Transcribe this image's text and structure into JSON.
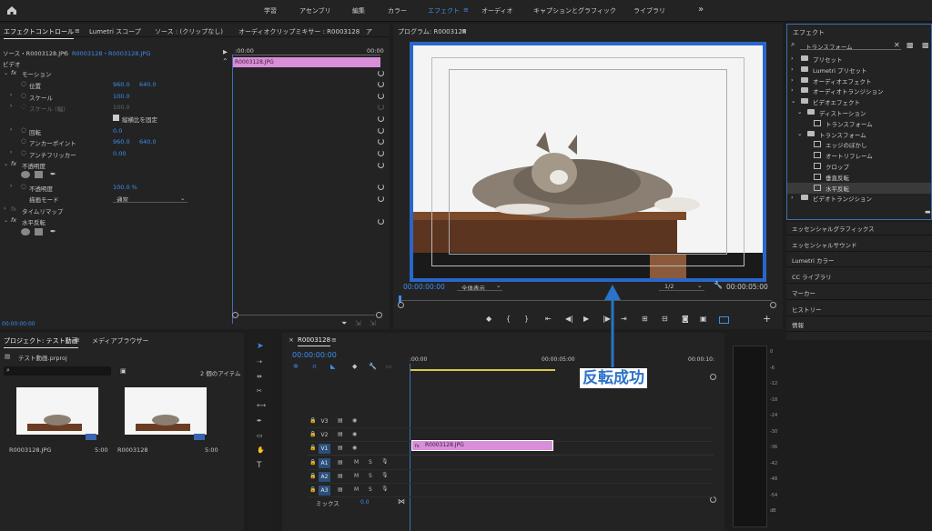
{
  "workspaces": [
    "学習",
    "アセンブリ",
    "編集",
    "カラー",
    "エフェクト",
    "オーディオ",
    "キャプションとグラフィック",
    "ライブラリ"
  ],
  "workspaces_active": "エフェクト",
  "home_icon": "home-icon",
  "more_icon": "»",
  "ec": {
    "tabs": [
      "エフェクトコントロール",
      "Lumetri スコープ",
      "ソース : (クリップなし)",
      "オーディオクリップミキサー : R0003128"
    ],
    "more": "ア",
    "source": "ソース・R0003128.JPG",
    "seq": "R0003128・R0003128.JPG",
    "time_start": ":00:00",
    "time_end": "00:00",
    "clip": "R0003128.JPG",
    "video": "ビデオ",
    "motion": "モーション",
    "position": "位置",
    "pos_x": "960.0",
    "pos_y": "640.0",
    "scale": "スケール",
    "scale_val": "100.0",
    "scale_w": "スケール (幅)",
    "scale_w_val": "100.0",
    "uniform": "縦横比を固定",
    "rotation": "回転",
    "rotation_val": "0.0",
    "anchor": "アンカーポイント",
    "anchor_x": "960.0",
    "anchor_y": "640.0",
    "antiflicker": "アンチフリッカー",
    "antiflicker_val": "0.00",
    "opacity_group": "不透明度",
    "opacity": "不透明度",
    "opacity_val": "100.0 %",
    "blend": "描画モード",
    "blend_val": "通常",
    "timeremap": "タイムリマップ",
    "hflip": "水平反転",
    "timecode": "00:00:00:00"
  },
  "program": {
    "title": "プログラム: R0003128",
    "timecode": "00:00:00:00",
    "fit": "全体表示",
    "res": "1/2",
    "duration": "00:00:05:00"
  },
  "effects": {
    "title": "エフェクト",
    "search": "トランスフォーム",
    "tree": [
      {
        "label": "プリセット",
        "level": 0,
        "arrow": "›",
        "icon": "folder"
      },
      {
        "label": "Lumetri プリセット",
        "level": 0,
        "arrow": "›",
        "icon": "folder"
      },
      {
        "label": "オーディオエフェクト",
        "level": 0,
        "arrow": "›",
        "icon": "folder"
      },
      {
        "label": "オーディオトランジション",
        "level": 0,
        "arrow": "›",
        "icon": "folder"
      },
      {
        "label": "ビデオエフェクト",
        "level": 0,
        "arrow": "⌄",
        "icon": "folder"
      },
      {
        "label": "ディストーション",
        "level": 1,
        "arrow": "⌄",
        "icon": "folder"
      },
      {
        "label": "トランスフォーム",
        "level": 2,
        "arrow": "",
        "icon": "fx"
      },
      {
        "label": "トランスフォーム",
        "level": 1,
        "arrow": "⌄",
        "icon": "folder"
      },
      {
        "label": "エッジのぼかし",
        "level": 2,
        "arrow": "",
        "icon": "fx"
      },
      {
        "label": "オートリフレーム",
        "level": 2,
        "arrow": "",
        "icon": "fx"
      },
      {
        "label": "クロップ",
        "level": 2,
        "arrow": "",
        "icon": "fx"
      },
      {
        "label": "垂直反転",
        "level": 2,
        "arrow": "",
        "icon": "fx"
      },
      {
        "label": "水平反転",
        "level": 2,
        "arrow": "",
        "icon": "fx",
        "selected": true
      },
      {
        "label": "ビデオトランジション",
        "level": 0,
        "arrow": "›",
        "icon": "folder"
      }
    ],
    "sections": [
      "エッセンシャルグラフィックス",
      "エッセンシャルサウンド",
      "Lumetri カラー",
      "CC ライブラリ",
      "マーカー",
      "ヒストリー",
      "情報"
    ]
  },
  "project": {
    "tab": "プロジェクト: テスト動画",
    "tab2": "メディアブラウザー",
    "file": "テスト動画.prproj",
    "count": "2 個のアイテム",
    "items": [
      {
        "name": "R0003128.JPG",
        "dur": "5:00"
      },
      {
        "name": "R0003128",
        "dur": "5:00"
      }
    ]
  },
  "timeline": {
    "tab": "R0003128",
    "timecode": "00:00:00:00",
    "ruler": [
      ":00:00",
      "00:00:05:00",
      "00:00:10:"
    ],
    "vtracks": [
      "V3",
      "V2",
      "V1"
    ],
    "atracks": [
      "A1",
      "A2",
      "A3"
    ],
    "mix": "ミックス",
    "mix_val": "0.0",
    "clip": "R0003128.JPG",
    "m": "M",
    "s": "S"
  },
  "meter_scale": [
    "0",
    "-6",
    "-12",
    "-18",
    "-24",
    "-30",
    "-36",
    "-42",
    "-48",
    "-54",
    "dB"
  ],
  "annotation": "反転成功",
  "colors": {
    "accent": "#3d8ef0",
    "clip": "#d98ed9",
    "frame": "#2a66c9",
    "annotation": "#2a73c8"
  }
}
